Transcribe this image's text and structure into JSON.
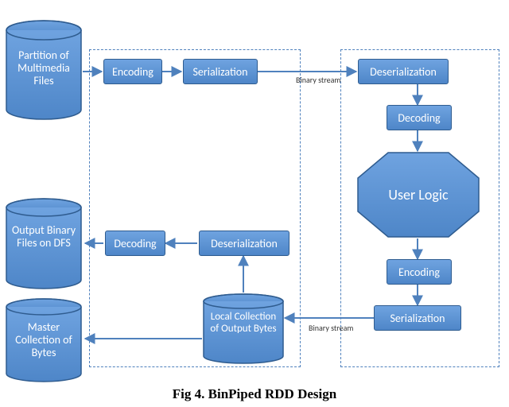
{
  "caption": "Fig 4. BinPiped RDD Design",
  "cylinders": {
    "partition": "Partition of Multimedia Files",
    "output_binary": "Output Binary Files on DFS",
    "master_bytes": "Master Collection of Bytes",
    "local_bytes": "Local Collection of Output Bytes"
  },
  "nodes": {
    "encoding_top": "Encoding",
    "serialization_top": "Serialization",
    "deserialization_top": "Deserialization",
    "decoding_top": "Decoding",
    "user_logic": "User Logic",
    "encoding_bot": "Encoding",
    "serialization_bot": "Serialization",
    "decoding_left": "Decoding",
    "deserialization_left": "Deserialization"
  },
  "edge_labels": {
    "binary_stream_top": "Binary stream",
    "binary_stream_bot": "Binary stream"
  }
}
